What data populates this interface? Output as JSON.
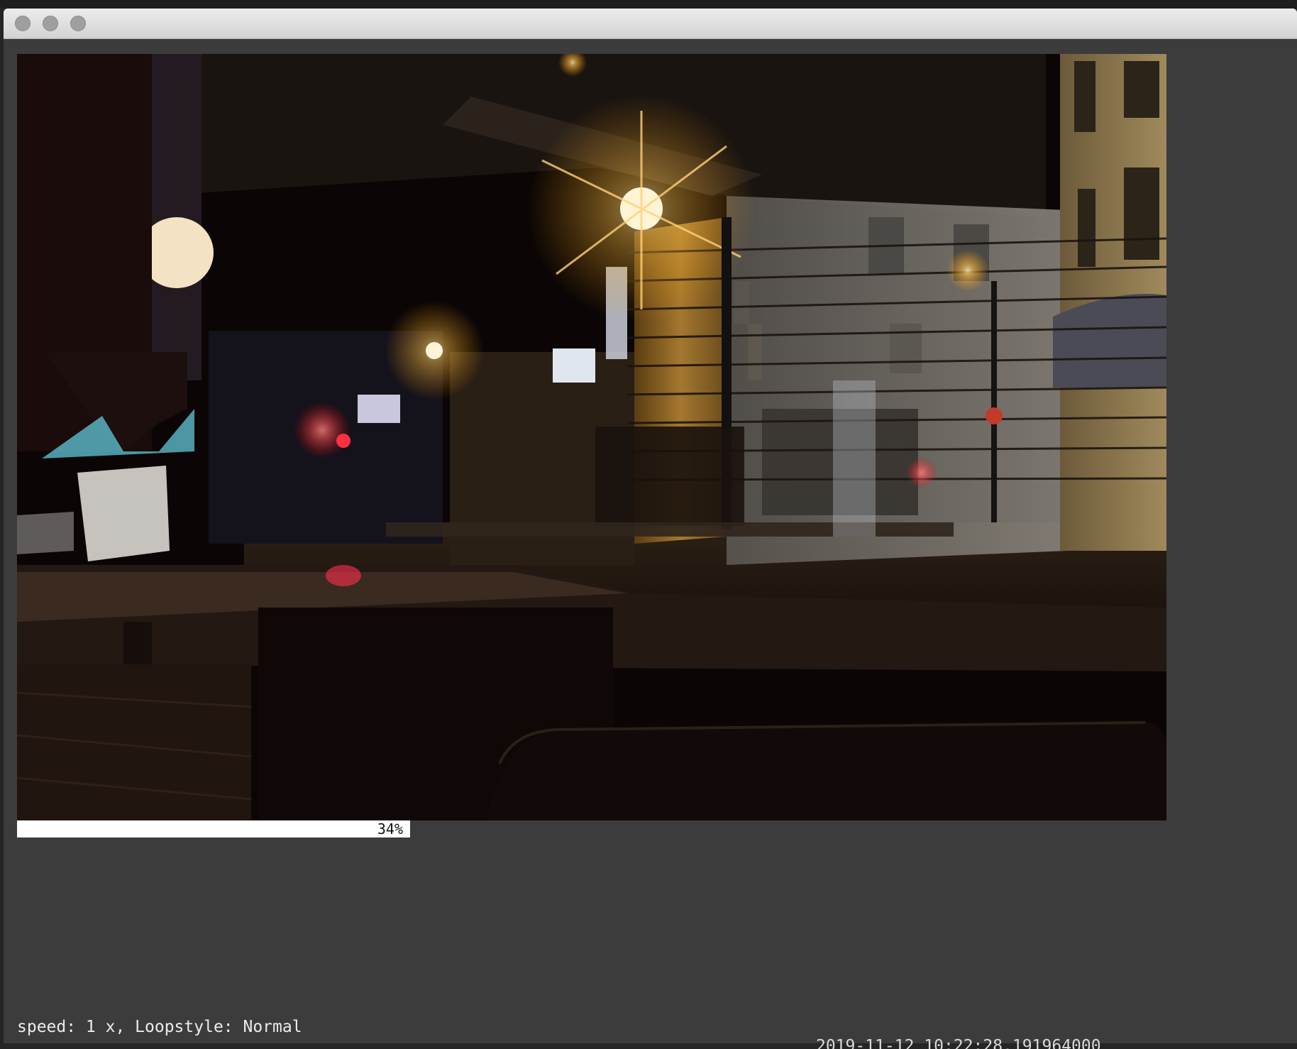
{
  "video": {
    "progress_percent": 34,
    "progress_label": "34%",
    "status_text": "speed: 1 x, Loopstyle: Normal"
  },
  "background": {
    "timestamp_text": "2019-11-12 10:22:28.191964000"
  },
  "colors": {
    "window_bg": "#3c3c3c",
    "progress_fill": "#ffffff",
    "status_text": "#ececec"
  }
}
